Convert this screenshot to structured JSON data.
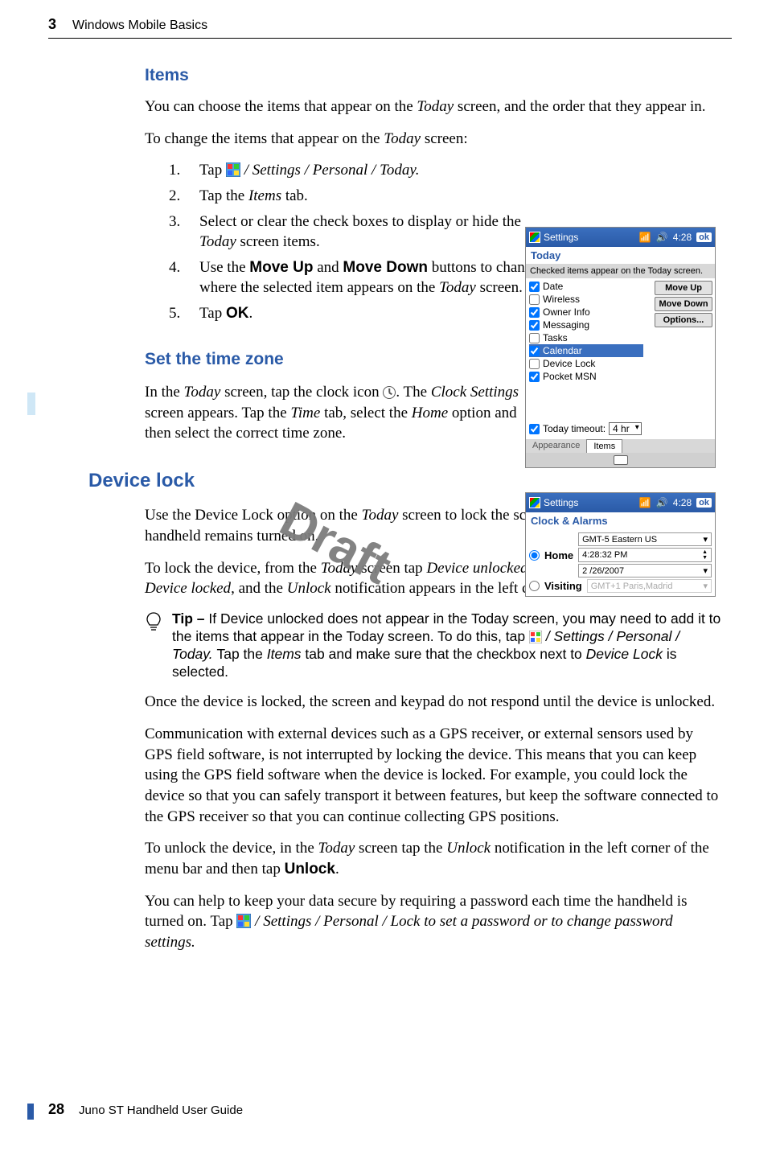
{
  "header": {
    "chapnum": "3",
    "chaptitle": "Windows Mobile Basics"
  },
  "footer": {
    "pagenum": "28",
    "title": "Juno ST Handheld User Guide"
  },
  "watermark": "Draft",
  "headings": {
    "items": "Items",
    "timezone": "Set the time zone",
    "devicelock": "Device lock"
  },
  "paras": {
    "items_intro": "You can choose the items that appear on the Today screen, and the order that they appear in.",
    "items_lead": "To change the items that appear on the Today screen:",
    "tz_a": "In the Today screen, tap the clock icon ",
    "tz_b": ". The Clock Settings screen appears. Tap the Time tab, select the Home option and then select the correct time zone.",
    "dl1": "Use the Device Lock option on the Today screen to lock the screen and keypad while the handheld remains turned on.",
    "dl2": "To lock the device, from the Today screen tap Device unlocked. The Today screen shows Device locked, and the Unlock notification appears in the left corner of the menu bar.",
    "dl3": "Once the device is locked, the screen and keypad do not respond until the device is unlocked.",
    "dl4": "Communication with external devices such as a GPS receiver, or external sensors used by GPS field software, is not interrupted by locking the device. This means that you can keep using the GPS field software when the device is locked. For example, you could lock the device so that you can safely transport it between features, but keep the software connected to the GPS receiver so that you can continue collecting GPS positions.",
    "dl5": "To unlock the device, in the Today screen tap the Unlock notification in the left corner of the menu bar and then tap Unlock.",
    "dl6": "You can help to keep your data secure by requiring a password each time the handheld is turned on. Tap ",
    "dl6b": " / Settings / Personal / Lock to set a password or to change password settings."
  },
  "steps": {
    "s1a": "Tap ",
    "s1b": " / Settings / Personal / Today.",
    "s2": "Tap the Items tab.",
    "s3": "Select or clear the check boxes to display or hide the Today screen items.",
    "s4a": "Use the ",
    "s4_moveup": "Move Up",
    "s4_and": " and ",
    "s4_movedown": "Move Down",
    "s4b": " buttons to change where the selected item appears on the Today screen.",
    "s5a": "Tap ",
    "s5_ok": "OK",
    "s5b": "."
  },
  "tip": {
    "label": "Tip – ",
    "a": "If Device unlocked does not appear in the Today screen, you may need to add it to the items that appear in the Today screen. To do this, tap ",
    "b": " / Settings / Personal  / Today. ",
    "c": "Tap the Items tab and make sure that the checkbox next to Device Lock is selected."
  },
  "shot1": {
    "title": "Settings",
    "time": "4:28",
    "ok": "ok",
    "subhead": "Today",
    "note": "Checked items appear on the Today screen.",
    "items": [
      "Date",
      "Wireless",
      "Owner Info",
      "Messaging",
      "Tasks",
      "Calendar",
      "Device Lock",
      "Pocket MSN"
    ],
    "checked": [
      true,
      false,
      true,
      true,
      false,
      true,
      false,
      true
    ],
    "selected_index": 5,
    "btns": {
      "moveup": "Move Up",
      "movedown": "Move Down",
      "options": "Options..."
    },
    "timeout_label": "Today timeout:",
    "timeout_value": "4 hr",
    "tabs": [
      "Appearance",
      "Items"
    ],
    "active_tab": 1
  },
  "shot2": {
    "title": "Settings",
    "time": "4:28",
    "ok": "ok",
    "subhead": "Clock & Alarms",
    "home": "Home",
    "visiting": "Visiting",
    "tz": "GMT-5 Eastern US",
    "clock": "4:28:32 PM",
    "date": "2 /26/2007",
    "tz2": "GMT+1 Paris,Madrid"
  }
}
